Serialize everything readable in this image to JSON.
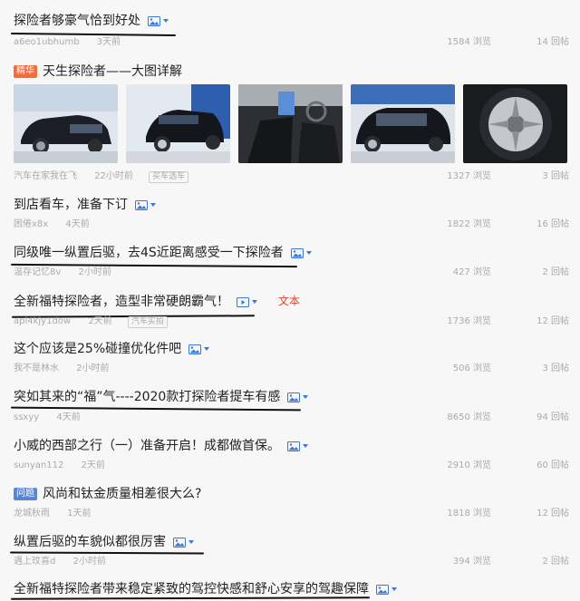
{
  "posts": [
    {
      "title": "探险者够豪气恰到好处",
      "author": "a6eo1ubhumb",
      "time": "3天前",
      "views": "1584 浏览",
      "replies": "14 回帖",
      "icon": "image-icon"
    },
    {
      "tag": "精华",
      "title": "天生探险者——大图详解",
      "author": "汽车在家我在飞",
      "time": "22小时前",
      "source": "买车选车",
      "views": "1327 浏览",
      "replies": "3 回帖"
    },
    {
      "title": "到店看车，准备下订",
      "author": "困倦x8x",
      "time": "4天前",
      "views": "1822 浏览",
      "replies": "16 回帖",
      "icon": "image-icon"
    },
    {
      "title": "同级唯一纵置后驱，去4S近距离感受一下探险者",
      "author": "温存记忆8v",
      "time": "2小时前",
      "views": "427 浏览",
      "replies": "2 回帖",
      "icon": "image-icon"
    },
    {
      "title": "全新福特探险者，造型非常硬朗霸气！",
      "author": "api4kjy1dow",
      "time": "2天前",
      "source": "汽车实拍",
      "views": "1736 浏览",
      "replies": "12 回帖",
      "icon": "video-icon",
      "note": "文本"
    },
    {
      "title": "这个应该是25%碰撞优化件吧",
      "author": "我不是林水",
      "time": "2小时前",
      "views": "506 浏览",
      "replies": "3 回帖",
      "icon": "image-icon"
    },
    {
      "title": "突如其来的“福”气----2020款打探险者提车有感",
      "author": "ssxyy",
      "time": "4天前",
      "views": "8650 浏览",
      "replies": "94 回帖",
      "icon": "image-icon"
    },
    {
      "title": "小威的西部之行（一）准备开启！成都做首保。",
      "author": "sunyan112",
      "time": "2天前",
      "views": "2910 浏览",
      "replies": "60 回帖",
      "icon": "image-icon"
    },
    {
      "tag": "问题",
      "title": "风尚和钛金质量相差很大么?",
      "author": "龙城秋雨",
      "time": "1天前",
      "views": "1818 浏览",
      "replies": "12 回帖"
    },
    {
      "title": "纵置后驱的车貌似都很厉害",
      "author": "遇上玟喜d",
      "time": "2小时前",
      "views": "394 浏览",
      "replies": "2 回帖",
      "icon": "image-icon"
    },
    {
      "title": "全新福特探险者带来稳定紧致的驾控快感和舒心安享的驾趣保障",
      "icon": "image-icon"
    }
  ],
  "colors": {
    "accent": "#3a78d8",
    "essence_tag": "#f56a3a",
    "question_tag": "#5a86d6",
    "note": "#d84a2f"
  }
}
